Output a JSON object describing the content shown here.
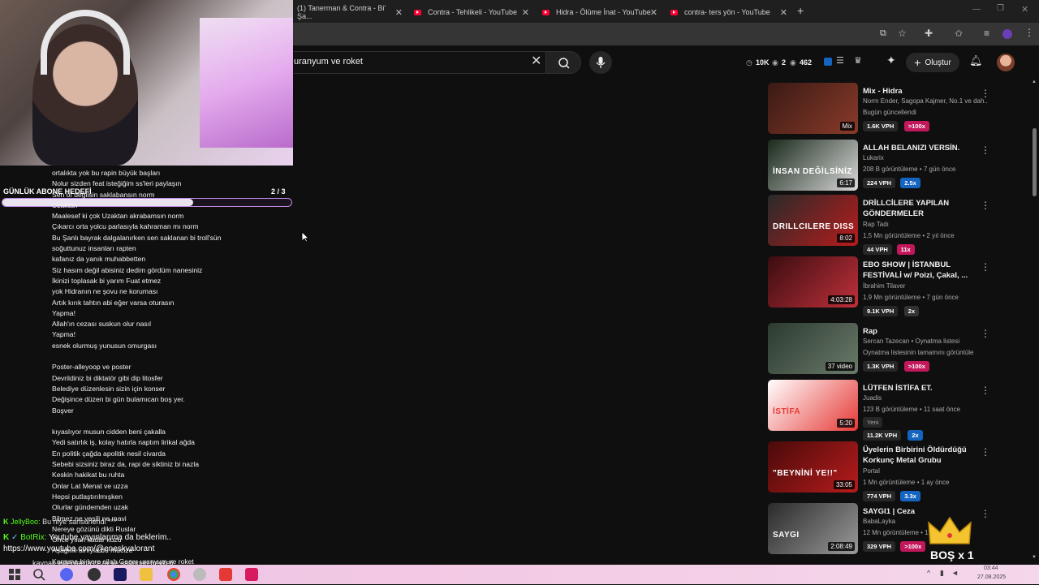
{
  "tabs": [
    {
      "label": "(1) Tanerman & Contra - Bi' Şa..."
    },
    {
      "label": "Contra - Tehlikeli - YouTube"
    },
    {
      "label": "Hidra - Ölüme İnat - YouTube"
    },
    {
      "label": "contra- ters yön - YouTube"
    }
  ],
  "search": {
    "query": "uranyum ve roket"
  },
  "header": {
    "stat1": "10K",
    "stat2": "2",
    "stat3": "462",
    "create_label": "Oluştur"
  },
  "overlay": {
    "title": "GÜNLÜK ABONE HEDEFİ",
    "progress_text": "2 / 3",
    "progress": 0.66
  },
  "lyrics": [
    "ortalıkta yok bu rapin büyük başları",
    "Nolur sizden feat isteğiğim ss'leri paylaşın",
    "Sen öf değilsin saklabansın norm",
    "Uzaktan",
    "Maalesef ki çok Uzaktan akrabamsın norm",
    "Çıkarcı orta yolcu parlasıyla kahraman mı norm",
    "Bu Şanlı bayrak dalgalanırken sen saklanan bi troll'sün",
    "soğuttunuz insanları rapten",
    "kafanız da yanık muhabbetten",
    "Siz hasım değil abisiniz dedim gördüm nanesiniz",
    "İkinizi toplasak bi yarım Fuat etmez",
    "yok Hidranın ne şovu ne koruması",
    "Artık kırık tahtın abi eğer varsa oturasın",
    "Yapma!",
    "Allah'ın cezası suskun olur nasıl",
    "Yapma!",
    "esnek olurmuş yunusun omurgası",
    "",
    "Poster-alleyoop ve poster",
    "Devrildiniz bi diktatör gibi dip litosfer",
    "Belediye düzenlesin sizin için konser",
    "Değişince düzen bi gün bulamıcan boş yer.",
    "Boşver",
    "",
    "kıyaslıyor musun cidden beni çakalla",
    "Yedi satırlık iş, kolay hatırla naptım lirikal ağda",
    "En politik çağda apolitik nesil civarda",
    "Sebebi sizsiniz biraz da, rapi de siktiniz bi nazla",
    "Keskin hakikat bu ruhta",
    "Onlar Lat Menat ve uzza",
    "Hepsi putlaştırılmışken",
    "Olurlar gündemden uzak",
    "Bilmez ne yeşili ne mavi",
    "Nereye gözünü dikti Ruslar",
    "Önce yılan kadar kuzu",
    "Aşağılık alnıyla bu mucize",
    "Karşıma bi kere silah Geçer uranyum ve roket"
  ],
  "chat": [
    {
      "user": "JellyBoo:",
      "msg": "Bu niye sansürlendi ***"
    },
    {
      "user": "BotRix:",
      "msg": "Youtube yayınlarıma da beklerim.."
    },
    {
      "line": "https://www.youtube.com/@eneskvalorant"
    },
    {
      "line": "kaynak videolarda ceza ve sağonun heykeli"
    }
  ],
  "recommendations": [
    {
      "title": "Mix - Hidra",
      "meta1": "Norm Ender, Sagopa Kajmer, No.1 ve dah...",
      "meta2": "Bugün güncellendi",
      "duration": "Mix",
      "vph": "1.6K VPH",
      "mult": ">100x",
      "mult_color": "#c2185b",
      "thumb_colors": [
        "#3a1a14",
        "#8a3b2a"
      ]
    },
    {
      "title": "ALLAH BELANIZI VERSİN.",
      "meta1": "Lukarix",
      "meta2": "208 B görüntüleme • 7 gün önce",
      "duration": "6:17",
      "vph": "224 VPH",
      "mult": "2.5x",
      "mult_color": "#1565c0",
      "thumb_colors": [
        "#1a2a1c",
        "#d8d8d8"
      ]
    },
    {
      "title": "DRİLLCİLERE YAPILAN GÖNDERMELER",
      "meta1": "Rap Tadı",
      "meta2": "1,5 Mn görüntüleme • 2 yıl önce",
      "duration": "8:02",
      "vph": "44 VPH",
      "mult": "11x",
      "mult_color": "#c2185b",
      "thumb_colors": [
        "#2a2a2a",
        "#b71c1c"
      ]
    },
    {
      "title": "EBO SHOW | İSTANBUL FESTİVALİ w/ Poizi, Çakal, ...",
      "meta1": "İbrahim Tilaver",
      "meta2": "1,9 Mn görüntüleme • 7 gün önce",
      "duration": "4:03:28",
      "vph": "9.1K VPH",
      "mult": "2x",
      "mult_color": "#333333",
      "thumb_colors": [
        "#3a0d10",
        "#c0303a"
      ]
    },
    {
      "title": "Rap",
      "meta1": "Sercan Tazecan • Oynatma listesi",
      "meta2": "Oynatma listesinin tamamını görüntüle",
      "duration": "37 video",
      "vph": "1.3K VPH",
      "mult": ">100x",
      "mult_color": "#c2185b",
      "thumb_colors": [
        "#2c3a30",
        "#6a7a6a"
      ]
    },
    {
      "title": "LÜTFEN İSTİFA ET.",
      "meta1": "Juadis",
      "meta2": "123 B görüntüleme • 11 saat önce",
      "badge": "Yeni",
      "duration": "5:20",
      "vph": "11.2K VPH",
      "mult": "2x",
      "mult_color": "#1565c0",
      "thumb_colors": [
        "#ffffff",
        "#e53935"
      ]
    },
    {
      "title": "Üyelerin Birbirini Öldürdüğü Korkunç Metal Grubu",
      "meta1": "Portal",
      "meta2": "1 Mn görüntüleme • 1 ay önce",
      "duration": "33:05",
      "vph": "774 VPH",
      "mult": "3.3x",
      "mult_color": "#1565c0",
      "thumb_colors": [
        "#4a0a0a",
        "#b71c1c"
      ]
    },
    {
      "title": "SAYGI1 | Ceza",
      "meta1": "BabaLayka",
      "meta2": "12 Mn görüntüleme • 1 y",
      "duration": "2:08:49",
      "vph": "329 VPH",
      "mult": ">100x",
      "mult_color": "#c2185b",
      "thumb_colors": [
        "#2a2a2a",
        "#9a9a9a"
      ]
    }
  ],
  "thumb_text": {
    "r2": "İNSAN DEĞİLSİNİZ",
    "r3": "DRILLCILERE DISS",
    "r6": "İSTİFA",
    "r7": "\"BEYNİNİ YE!!\"",
    "r8": "SAYGI"
  },
  "crown": {
    "label": "BOŞ x 1"
  },
  "taskbar": {
    "time": "03:44",
    "date": "27.08.2025"
  }
}
